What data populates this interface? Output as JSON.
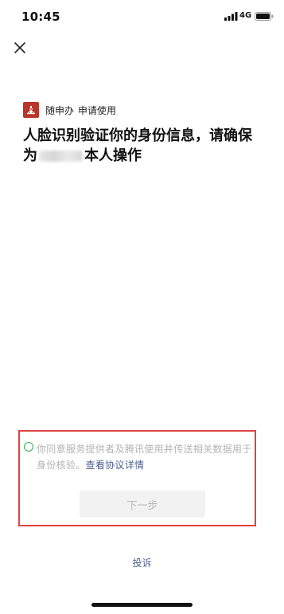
{
  "status_bar": {
    "time": "10:45",
    "network": "4G",
    "icons": [
      "signal-icon",
      "battery-icon"
    ]
  },
  "header": {
    "close_icon": "close-icon"
  },
  "app": {
    "name": "随申办",
    "action": "申请使用",
    "logo_icon": "suishenban-logo-icon",
    "logo_color": "#b8362a"
  },
  "main": {
    "title_part1": "人脸识别验证你的身份信息，请确保为",
    "title_part2": "本人操作"
  },
  "consent": {
    "text": "你同意服务提供者及腾讯使用并传送相关数据用于身份核验。",
    "link": "查看协议详情",
    "checked": false,
    "radio_color": "#2fb34a",
    "highlight_color": "#e0413f"
  },
  "actions": {
    "next_label": "下一步",
    "report_label": "投诉"
  },
  "colors": {
    "link": "#4a5f8c",
    "disabled_text": "#b9b9b9",
    "disabled_bg": "#f2f2f2"
  }
}
